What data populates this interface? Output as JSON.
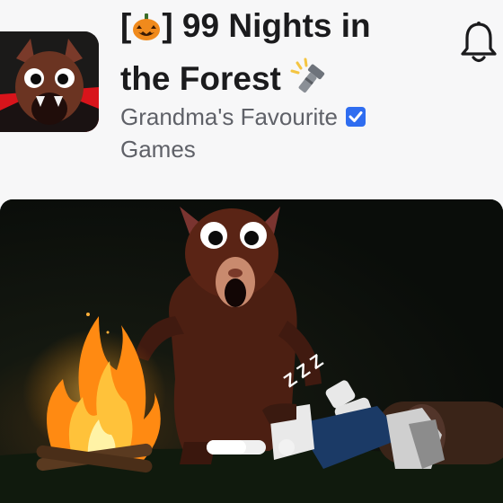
{
  "game": {
    "title_prefix": "[",
    "title_suffix": "] 99 Nights in",
    "title_line2": "the Forest",
    "creator_line1": "Grandma's Favourite",
    "creator_line2": "Games",
    "verified": true
  },
  "icons": {
    "seasonal": "pumpkin-icon",
    "flashlight": "flashlight-icon",
    "notify": "bell-icon",
    "verified": "verified-badge-icon"
  },
  "carousel": {
    "slide_count": 2,
    "active_index": 0,
    "snore_text": "Z Z Z"
  },
  "colors": {
    "background": "#f7f7f8",
    "title": "#1b1b1d",
    "creator": "#5f6168",
    "verified": "#2f6df0",
    "pumpkin": "#f08a1c"
  }
}
